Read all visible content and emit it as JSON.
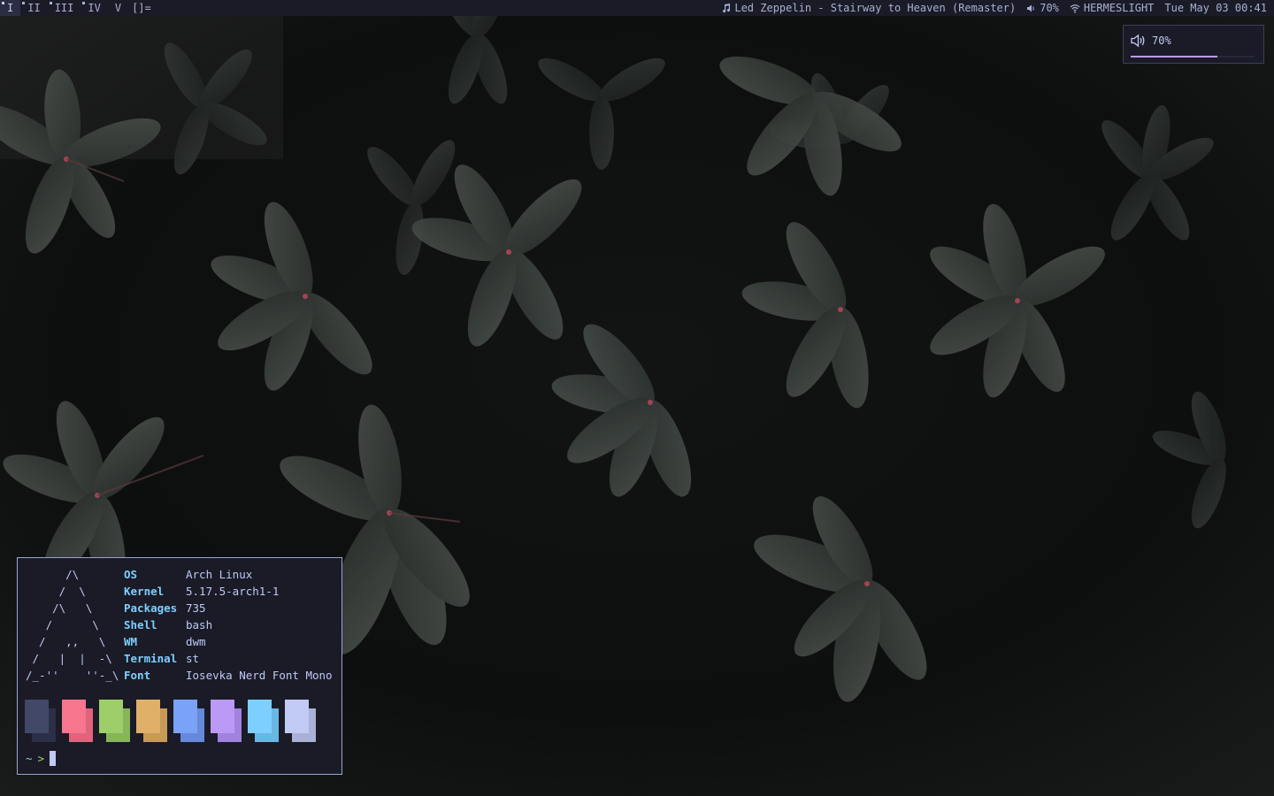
{
  "bar": {
    "tags": [
      {
        "label": "I",
        "occupied": true,
        "selected": true
      },
      {
        "label": "II",
        "occupied": true,
        "selected": false
      },
      {
        "label": "III",
        "occupied": true,
        "selected": false
      },
      {
        "label": "IV",
        "occupied": true,
        "selected": false
      },
      {
        "label": "V",
        "occupied": false,
        "selected": false
      }
    ],
    "layout_symbol": "[]=",
    "music": "Led Zeppelin - Stairway to Heaven (Remaster)",
    "volume": "70%",
    "network": "HERMESLIGHT",
    "datetime": "Tue May 03 00:41"
  },
  "volume_osd": {
    "label": "70%",
    "level": 0.7
  },
  "terminal": {
    "ascii_logo": [
      "      /\\",
      "     /  \\",
      "    /\\   \\",
      "   /      \\",
      "  /   ,,   \\",
      " /   |  |  -\\",
      "/_-''    ''-_\\"
    ],
    "info": [
      {
        "key": "OS",
        "value": "Arch Linux"
      },
      {
        "key": "Kernel",
        "value": "5.17.5-arch1-1"
      },
      {
        "key": "Packages",
        "value": "735"
      },
      {
        "key": "Shell",
        "value": "bash"
      },
      {
        "key": "WM",
        "value": "dwm"
      },
      {
        "key": "Terminal",
        "value": "st"
      },
      {
        "key": "Font",
        "value": "Iosevka Nerd Font Mono"
      }
    ],
    "palette": [
      {
        "front": "#414868",
        "back": "#2b2f47"
      },
      {
        "front": "#f7768e",
        "back": "#e0647c"
      },
      {
        "front": "#9ece6a",
        "back": "#86b55a"
      },
      {
        "front": "#e0af68",
        "back": "#c79a57"
      },
      {
        "front": "#7aa2f7",
        "back": "#6689db"
      },
      {
        "front": "#bb9af7",
        "back": "#a282df"
      },
      {
        "front": "#7dcfff",
        "back": "#68b8e6"
      },
      {
        "front": "#c0caf5",
        "back": "#a9b1d6"
      }
    ],
    "prompt_dir": "~",
    "prompt_symbol": ">"
  },
  "colors": {
    "bar_bg": "#1a1b26",
    "accent": "#bb9af7",
    "terminal_border": "#9aa5ce"
  },
  "icons": {
    "music": "music-note-icon",
    "volume": "speaker-icon",
    "network": "wifi-icon"
  }
}
